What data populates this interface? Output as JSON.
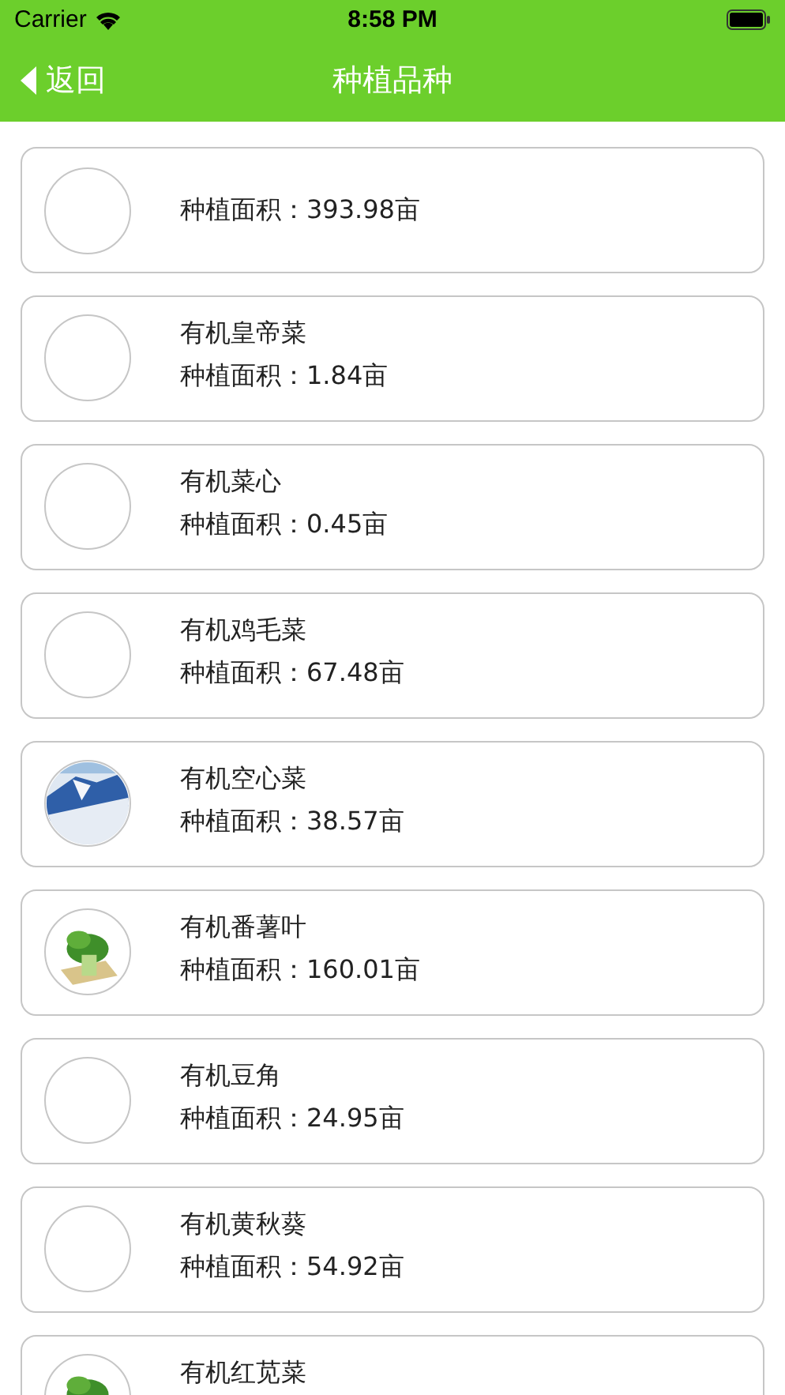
{
  "status_bar": {
    "carrier": "Carrier",
    "time": "8:58 PM"
  },
  "nav": {
    "back": "返回",
    "title": "种植品种"
  },
  "varieties": [
    {
      "area": "种植面积：393.98亩",
      "picture": false
    },
    {
      "name": "有机皇帝菜",
      "area": "种植面积：1.84亩",
      "picture": false
    },
    {
      "name": "有机菜心",
      "area": "种植面积：0.45亩",
      "picture": false
    },
    {
      "name": "有机鸡毛菜",
      "area": "种植面积：67.48亩",
      "picture": false
    },
    {
      "name": "有机空心菜",
      "area": "种植面积：38.57亩",
      "picture": true
    },
    {
      "name": "有机番薯叶",
      "area": "种植面积：160.01亩",
      "picture": true
    },
    {
      "name": "有机豆角",
      "area": "种植面积：24.95亩",
      "picture": false
    },
    {
      "name": "有机黄秋葵",
      "area": "种植面积：54.92亩",
      "picture": false
    },
    {
      "name": "有机红苋菜",
      "picture": true
    }
  ]
}
